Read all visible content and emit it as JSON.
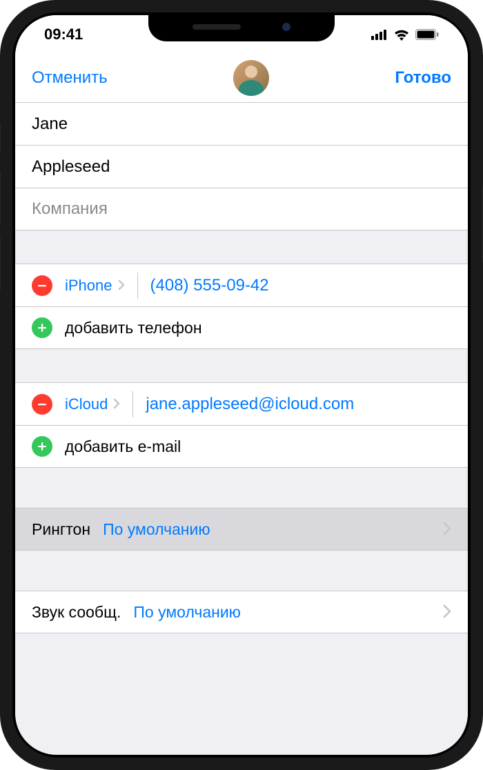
{
  "status": {
    "time": "09:41"
  },
  "nav": {
    "cancel": "Отменить",
    "done": "Готово"
  },
  "name": {
    "first": "Jane",
    "last": "Appleseed",
    "company_placeholder": "Компания"
  },
  "phone": {
    "type": "iPhone",
    "number": "(408) 555-09-42",
    "add": "добавить телефон"
  },
  "email": {
    "type": "iCloud",
    "address": "jane.appleseed@icloud.com",
    "add": "добавить e-mail"
  },
  "ringtone": {
    "label": "Рингтон",
    "value": "По умолчанию"
  },
  "texttone": {
    "label": "Звук сообщ.",
    "value": "По умолчанию"
  }
}
